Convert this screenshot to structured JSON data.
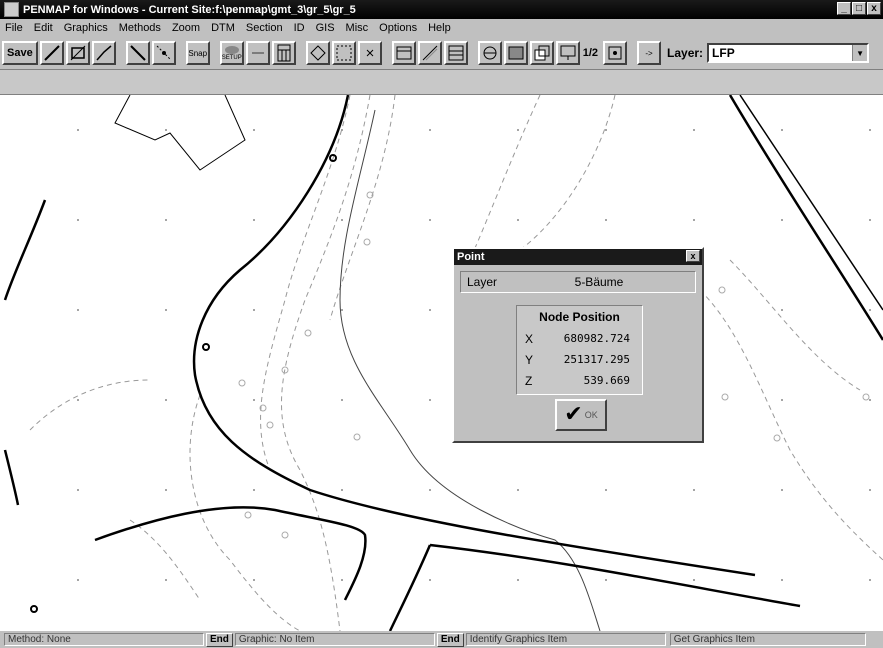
{
  "window": {
    "title": "PENMAP for Windows  -  Current Site:f:\\penmap\\gmt_3\\gr_5\\gr_5",
    "minimize": "_",
    "maximize": "□",
    "close": "x"
  },
  "menu": [
    "File",
    "Edit",
    "Graphics",
    "Methods",
    "Zoom",
    "DTM",
    "Section",
    "ID",
    "GIS",
    "Misc",
    "Options",
    "Help"
  ],
  "toolbar": {
    "save_label": "Save",
    "snap_label": "Snap",
    "setup_label": "SETUP",
    "page_label": "1/2",
    "arrow_label": "->",
    "layer_label": "Layer:",
    "layer_value": "LFP"
  },
  "dialog": {
    "title": "Point",
    "close": "x",
    "layer_label": "Layer",
    "layer_value": "5-Bäume",
    "node_header": "Node Position",
    "rows": [
      {
        "axis": "X",
        "value": "680982.724"
      },
      {
        "axis": "Y",
        "value": "251317.295"
      },
      {
        "axis": "Z",
        "value": "539.669"
      }
    ],
    "ok_label": "OK"
  },
  "status": {
    "method": "Method: None",
    "end1": "End",
    "graphic": "Graphic: No Item",
    "end2": "End",
    "identify": "Identify Graphics Item",
    "get": "Get Graphics Item"
  },
  "colors": {
    "title_bg": "#000000",
    "face": "#c0c0c0",
    "canvas": "#ffffff",
    "line": "#000000",
    "dashed": "#888888"
  }
}
